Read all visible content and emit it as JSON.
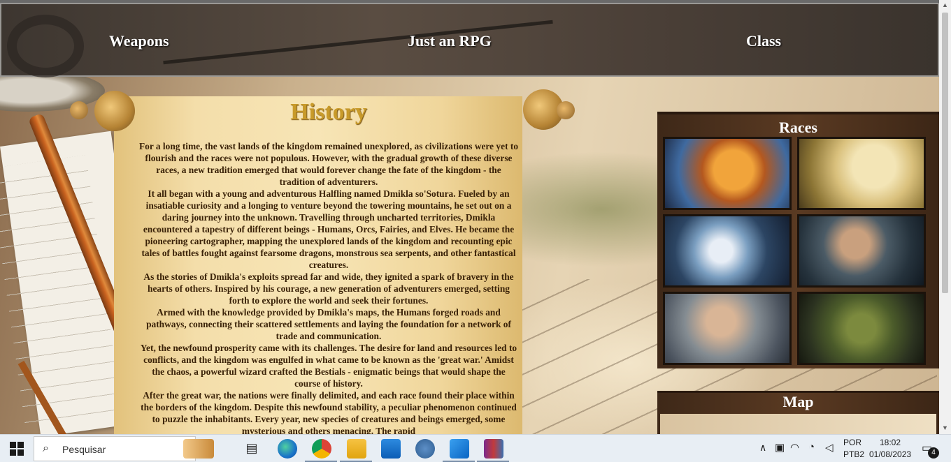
{
  "nav": {
    "left": "Weapons",
    "center": "Just an RPG",
    "right": "Class"
  },
  "history": {
    "title": "History",
    "paragraphs": [
      "For a long time, the vast lands of the kingdom remained unexplored, as civilizations were yet to flourish and the races were not populous. However, with the gradual growth of these diverse races, a new tradition emerged that would forever change the fate of the kingdom - the tradition of adventurers.",
      "It all began with a young and adventurous Halfling named Dmikla so'Sotura. Fueled by an insatiable curiosity and a longing to venture beyond the towering mountains, he set out on a daring journey into the unknown. Travelling through uncharted territories, Dmikla encountered a tapestry of different beings - Humans, Orcs, Fairies, and Elves. He became the pioneering cartographer, mapping the unexplored lands of the kingdom and recounting epic tales of battles fought against fearsome dragons, monstrous sea serpents, and other fantastical creatures.",
      "As the stories of Dmikla's exploits spread far and wide, they ignited a spark of bravery in the hearts of others. Inspired by his courage, a new generation of adventurers emerged, setting forth to explore the world and seek their fortunes.",
      "Armed with the knowledge provided by Dmikla's maps, the Humans forged roads and pathways, connecting their scattered settlements and laying the foundation for a network of trade and communication.",
      "Yet, the newfound prosperity came with its challenges. The desire for land and resources led to conflicts, and the kingdom was engulfed in what came to be known as the 'great war.' Amidst the chaos, a powerful wizard crafted the Bestials - enigmatic beings that would shape the course of history.",
      "After the great war, the nations were finally delimited, and each race found their place within the borders of the kingdom. Despite this newfound stability, a peculiar phenomenon continued to puzzle the inhabitants. Every year, new species of creatures and beings emerged, some mysterious and others menacing. The rapid"
    ]
  },
  "races": {
    "title": "Races"
  },
  "map": {
    "title": "Map"
  },
  "taskbar": {
    "search_placeholder": "Pesquisar",
    "lang_top": "POR",
    "lang_bottom": "PTB2",
    "time": "18:02",
    "date": "01/08/2023",
    "notifications": "4"
  }
}
